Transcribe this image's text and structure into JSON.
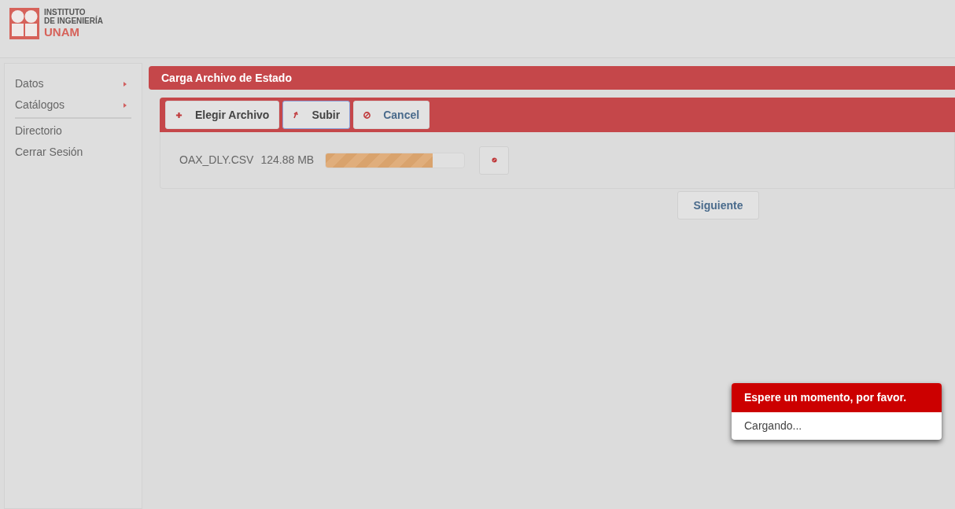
{
  "logo": {
    "lines": [
      "INSTITUTO",
      "DE INGENIERÍA"
    ],
    "name": "UNAM"
  },
  "sidebar": {
    "groups": [
      {
        "items": [
          {
            "label": "Datos",
            "kind": "submenu"
          },
          {
            "label": "Catálogos",
            "kind": "submenu"
          }
        ]
      },
      {
        "items": [
          {
            "label": "Directorio",
            "kind": "link"
          },
          {
            "label": "Cerrar Sesión",
            "kind": "link"
          }
        ]
      }
    ]
  },
  "panel": {
    "title": "Carga Archivo de Estado",
    "toolbar": [
      {
        "label": "Elegir Archivo",
        "kind": "add",
        "focused": false
      },
      {
        "label": "Subir",
        "kind": "upload",
        "focused": true
      },
      {
        "label": "Cancel",
        "kind": "cancel",
        "focused": false
      }
    ],
    "files": [
      {
        "name": "OAX_DLY.CSV",
        "size": "124.88 MB",
        "level": 0.77
      }
    ],
    "next_button": "Siguiente"
  },
  "toast": {
    "title": "Espere un momento, por favor.",
    "message": "Cargando..."
  }
}
